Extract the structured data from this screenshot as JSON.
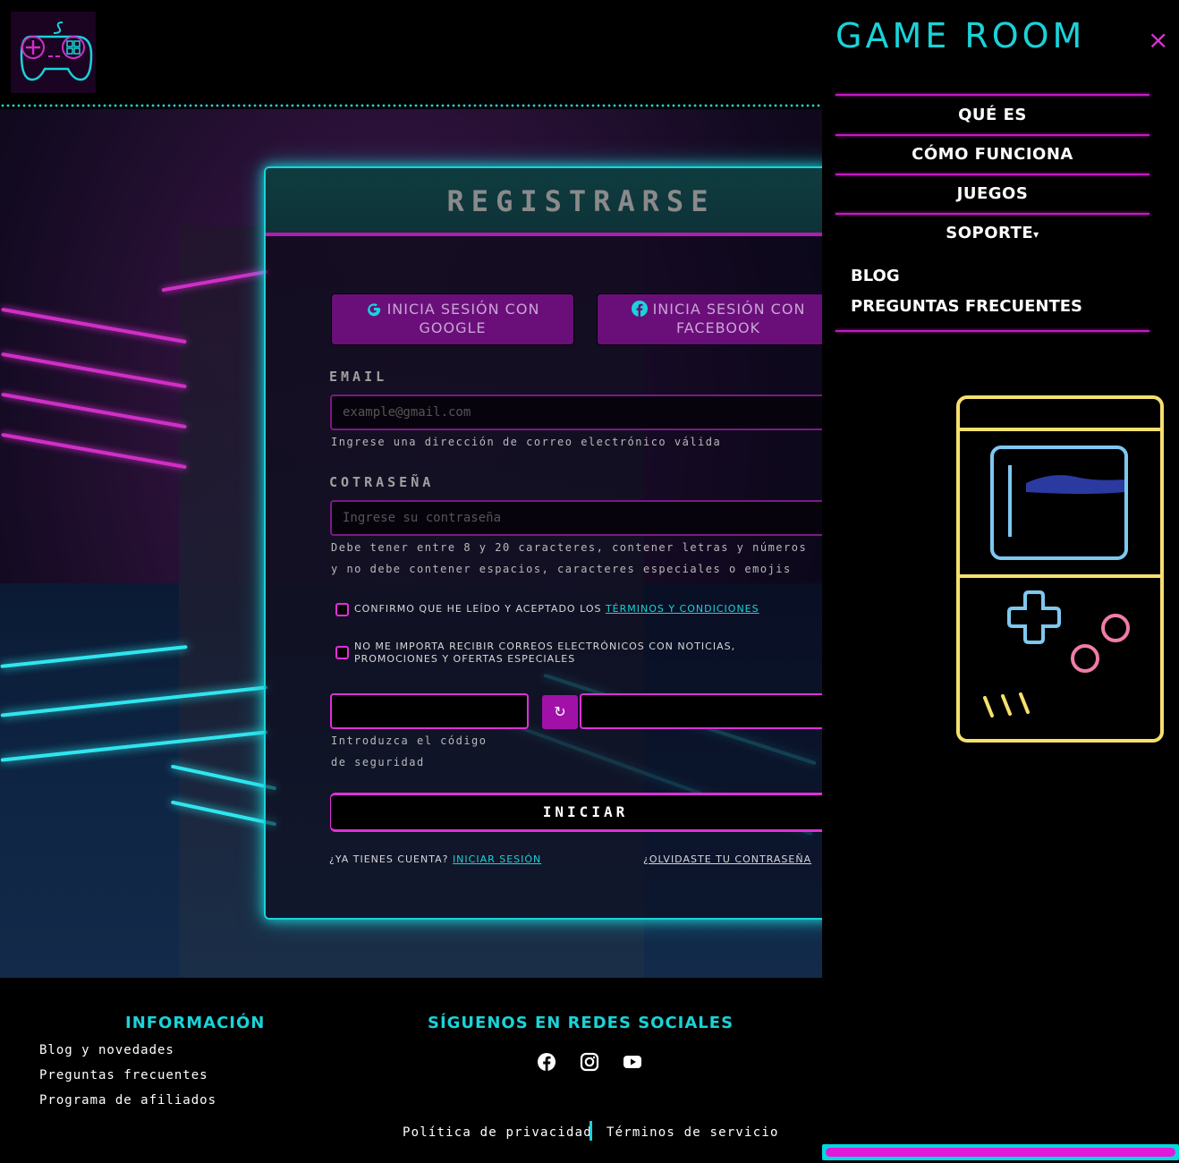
{
  "brand": {
    "menu_title": "GAME ROOM",
    "close_glyph": "×"
  },
  "nav": {
    "items": [
      "QUÉ ES",
      "CÓMO FUNCIONA",
      "JUEGOS",
      "SOPORTE"
    ],
    "dropdown_caret": "▾",
    "submenu": [
      "BLOG",
      "PREGUNTAS FRECUENTES"
    ]
  },
  "form": {
    "title": "REGISTRARSE",
    "google_label": "INICIA SESIÓN CON GOOGLE",
    "facebook_label": "INICIA SESIÓN CON FACEBOOK",
    "email_label": "EMAIL",
    "email_placeholder": "example@gmail.com",
    "email_hint": "Ingrese una dirección de correo electrónico válida",
    "password_label": "COTRASEÑA",
    "password_placeholder": "Ingrese su contraseña",
    "password_hint": "Debe tener entre 8 y 20 caracteres, contener letras y números y no debe contener espacios, caracteres especiales o emojis",
    "terms_prefix": "Confirmo que he leído y aceptado los",
    "terms_link": "términos y condiciones",
    "newsletter": "No me importa recibir correos electrónicos con noticias, promociones y ofertas especiales",
    "captcha_hint": "Introduzca el código de seguridad",
    "refresh_glyph": "↻",
    "submit_label": "INICIAR",
    "have_account": "¿Ya tienes cuenta?",
    "login_link": "Iniciar sesión",
    "forgot_link": "¿Olvidaste tu contraseña"
  },
  "footer": {
    "info_title": "INFORMACIÓN",
    "info_links": [
      "Blog y novedades",
      "Preguntas frecuentes",
      "Programa de afiliados"
    ],
    "social_title": "SÍGUENOS EN REDES SOCIALES",
    "social_icons": [
      "facebook-icon",
      "instagram-icon",
      "youtube-icon"
    ],
    "privacy": "Política de privacidad",
    "tos": "Términos de servicio"
  },
  "colors": {
    "cyan": "#1ad3d8",
    "magenta": "#e02fd8",
    "purple": "#6a0f7a",
    "yellow": "#f5e06e"
  }
}
